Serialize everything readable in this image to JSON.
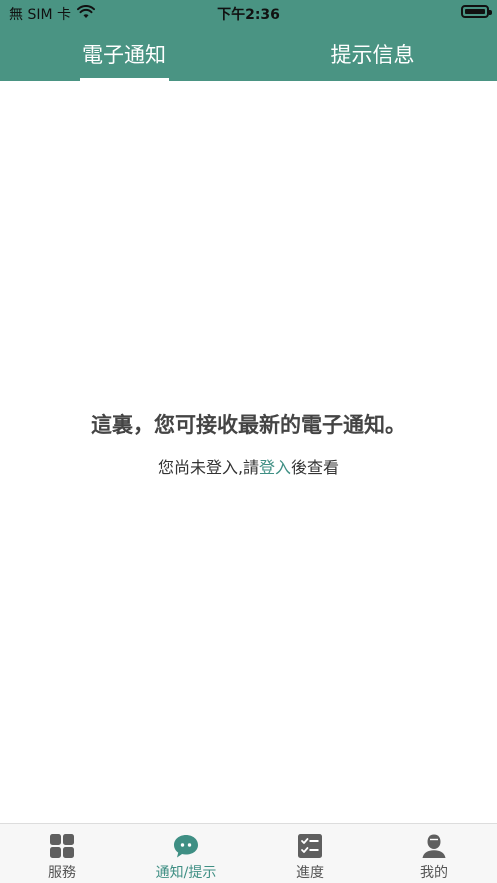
{
  "status_bar": {
    "carrier": "無 SIM 卡",
    "time": "下午2:36"
  },
  "tabs": [
    {
      "label": "電子通知",
      "active": true
    },
    {
      "label": "提示信息",
      "active": false
    }
  ],
  "main": {
    "title": "這裏，您可接收最新的電子通知。",
    "subtitle_prefix": "您尚未登入,請",
    "login_link": "登入",
    "subtitle_suffix": "後查看"
  },
  "bottom_nav": [
    {
      "label": "服務",
      "icon": "grid-icon",
      "active": false
    },
    {
      "label": "通知/提示",
      "icon": "chat-bubble-icon",
      "active": true
    },
    {
      "label": "進度",
      "icon": "checklist-icon",
      "active": false
    },
    {
      "label": "我的",
      "icon": "user-icon",
      "active": false
    }
  ],
  "colors": {
    "brand": "#4a9483",
    "link": "#3f8f84",
    "inactive_icon": "#5f5f5f"
  }
}
